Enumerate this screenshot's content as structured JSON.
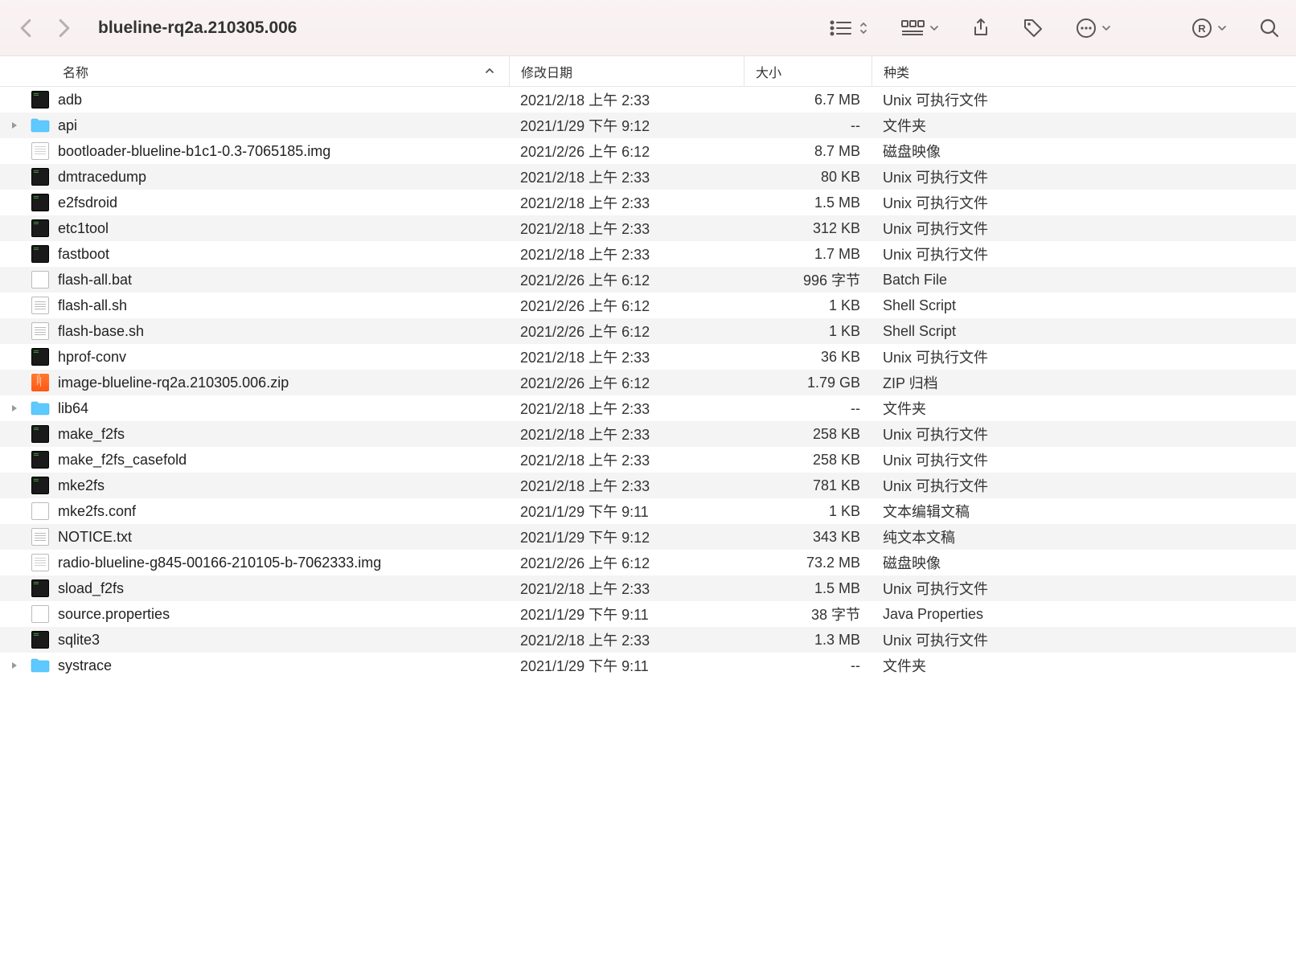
{
  "window": {
    "title": "blueline-rq2a.210305.006"
  },
  "columns": {
    "name": "名称",
    "date": "修改日期",
    "size": "大小",
    "kind": "种类"
  },
  "files": [
    {
      "icon": "exec",
      "folder": false,
      "name": "adb",
      "date": "2021/2/18 上午 2:33",
      "size": "6.7 MB",
      "kind": "Unix 可执行文件"
    },
    {
      "icon": "folder",
      "folder": true,
      "name": "api",
      "date": "2021/1/29 下午 9:12",
      "size": "--",
      "kind": "文件夹"
    },
    {
      "icon": "img",
      "folder": false,
      "name": "bootloader-blueline-b1c1-0.3-7065185.img",
      "date": "2021/2/26 上午 6:12",
      "size": "8.7 MB",
      "kind": "磁盘映像"
    },
    {
      "icon": "exec",
      "folder": false,
      "name": "dmtracedump",
      "date": "2021/2/18 上午 2:33",
      "size": "80 KB",
      "kind": "Unix 可执行文件"
    },
    {
      "icon": "exec",
      "folder": false,
      "name": "e2fsdroid",
      "date": "2021/2/18 上午 2:33",
      "size": "1.5 MB",
      "kind": "Unix 可执行文件"
    },
    {
      "icon": "exec",
      "folder": false,
      "name": "etc1tool",
      "date": "2021/2/18 上午 2:33",
      "size": "312 KB",
      "kind": "Unix 可执行文件"
    },
    {
      "icon": "exec",
      "folder": false,
      "name": "fastboot",
      "date": "2021/2/18 上午 2:33",
      "size": "1.7 MB",
      "kind": "Unix 可执行文件"
    },
    {
      "icon": "doc",
      "folder": false,
      "name": "flash-all.bat",
      "date": "2021/2/26 上午 6:12",
      "size": "996 字节",
      "kind": "Batch File"
    },
    {
      "icon": "txt",
      "folder": false,
      "name": "flash-all.sh",
      "date": "2021/2/26 上午 6:12",
      "size": "1 KB",
      "kind": "Shell Script"
    },
    {
      "icon": "txt",
      "folder": false,
      "name": "flash-base.sh",
      "date": "2021/2/26 上午 6:12",
      "size": "1 KB",
      "kind": "Shell Script"
    },
    {
      "icon": "exec",
      "folder": false,
      "name": "hprof-conv",
      "date": "2021/2/18 上午 2:33",
      "size": "36 KB",
      "kind": "Unix 可执行文件"
    },
    {
      "icon": "zip",
      "folder": false,
      "name": "image-blueline-rq2a.210305.006.zip",
      "date": "2021/2/26 上午 6:12",
      "size": "1.79 GB",
      "kind": "ZIP 归档"
    },
    {
      "icon": "folder",
      "folder": true,
      "name": "lib64",
      "date": "2021/2/18 上午 2:33",
      "size": "--",
      "kind": "文件夹"
    },
    {
      "icon": "exec",
      "folder": false,
      "name": "make_f2fs",
      "date": "2021/2/18 上午 2:33",
      "size": "258 KB",
      "kind": "Unix 可执行文件"
    },
    {
      "icon": "exec",
      "folder": false,
      "name": "make_f2fs_casefold",
      "date": "2021/2/18 上午 2:33",
      "size": "258 KB",
      "kind": "Unix 可执行文件"
    },
    {
      "icon": "exec",
      "folder": false,
      "name": "mke2fs",
      "date": "2021/2/18 上午 2:33",
      "size": "781 KB",
      "kind": "Unix 可执行文件"
    },
    {
      "icon": "doc",
      "folder": false,
      "name": "mke2fs.conf",
      "date": "2021/1/29 下午 9:11",
      "size": "1 KB",
      "kind": "文本编辑文稿"
    },
    {
      "icon": "txt",
      "folder": false,
      "name": "NOTICE.txt",
      "date": "2021/1/29 下午 9:12",
      "size": "343 KB",
      "kind": "纯文本文稿"
    },
    {
      "icon": "img",
      "folder": false,
      "name": "radio-blueline-g845-00166-210105-b-7062333.img",
      "date": "2021/2/26 上午 6:12",
      "size": "73.2 MB",
      "kind": "磁盘映像"
    },
    {
      "icon": "exec",
      "folder": false,
      "name": "sload_f2fs",
      "date": "2021/2/18 上午 2:33",
      "size": "1.5 MB",
      "kind": "Unix 可执行文件"
    },
    {
      "icon": "doc",
      "folder": false,
      "name": "source.properties",
      "date": "2021/1/29 下午 9:11",
      "size": "38 字节",
      "kind": "Java Properties"
    },
    {
      "icon": "exec",
      "folder": false,
      "name": "sqlite3",
      "date": "2021/2/18 上午 2:33",
      "size": "1.3 MB",
      "kind": "Unix 可执行文件"
    },
    {
      "icon": "folder",
      "folder": true,
      "name": "systrace",
      "date": "2021/1/29 下午 9:11",
      "size": "--",
      "kind": "文件夹"
    }
  ]
}
